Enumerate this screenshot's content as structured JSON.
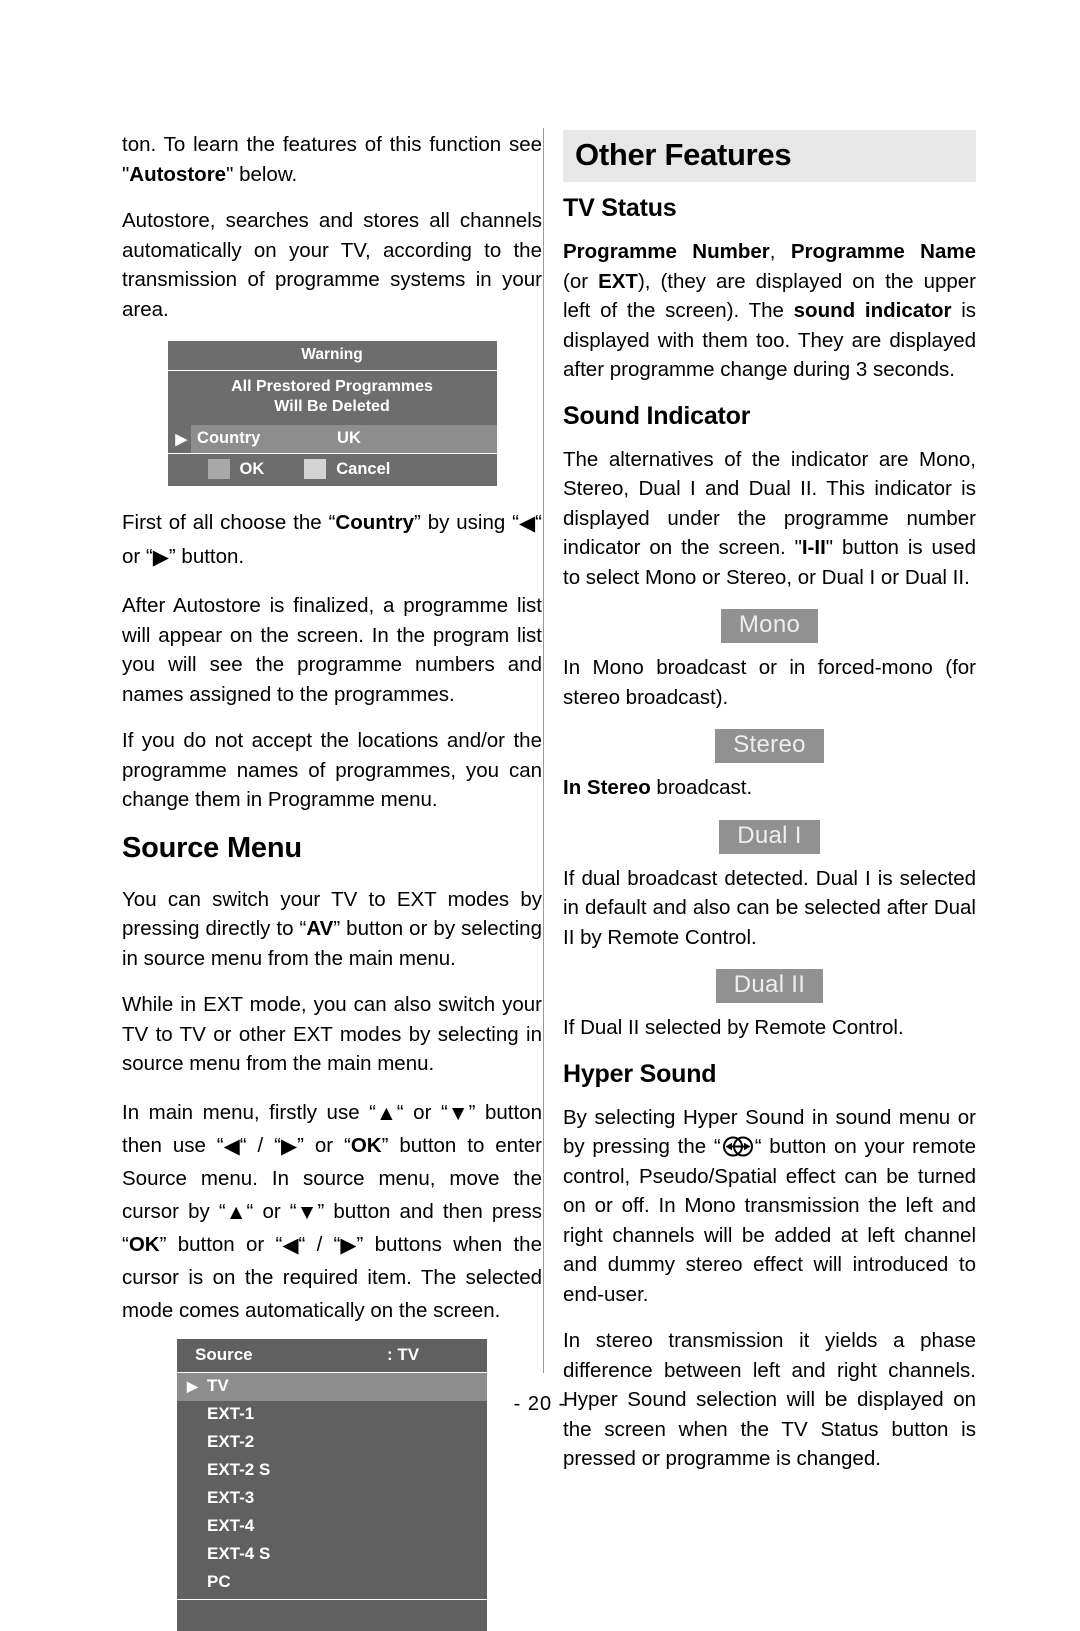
{
  "page": {
    "number_label": "- 20 -"
  },
  "left_column": {
    "paragraphs": {
      "p1_a": "ton. To learn the features of this function see \"",
      "p1_bold": "Autostore",
      "p1_b": "\" below.",
      "p2": "Autostore, searches and stores all channels automatically on your TV, according to the transmission of programme systems in your area.",
      "p3_a": "First of all choose the “",
      "p3_bold": "Country",
      "p3_b": "” by using “",
      "p3_c": "“ or “",
      "p3_d": "” button.",
      "p4": "After Autostore is finalized, a programme list will appear on the screen. In the program list you will see the programme numbers and names assigned to the programmes.",
      "p5": "If you do not accept the locations and/or the programme names of programmes, you can change them in Programme menu.",
      "p6_a": "You can switch your TV to EXT modes by pressing directly to “",
      "p6_bold": "AV",
      "p6_b": "” button or by selecting in source menu from the main menu.",
      "p7": "While in EXT mode, you can also switch your TV to TV or other EXT modes by selecting in source menu from the main menu.",
      "p8_a": "In main menu, firstly use “",
      "p8_b": "“ or “",
      "p8_c": "” button then use “",
      "p8_d": "“ / “",
      "p8_e": "” or “",
      "p8_ok1": "OK",
      "p8_f": "” button to enter Source menu. In source menu, move the cursor by “",
      "p8_g": "“ or “",
      "p8_h": "” button and then press “",
      "p8_ok2": "OK",
      "p8_i": "” button or “",
      "p8_j": "“ / “",
      "p8_k": "” buttons when the cursor is on the required item. The selected mode comes automatically on the screen."
    },
    "headings": {
      "source_menu": "Source Menu"
    },
    "warning_dialog": {
      "title": "Warning",
      "message_line1": "All Prestored  Programmes",
      "message_line2": "Will Be Deleted",
      "country_key": "Country",
      "country_value": "UK",
      "ok_label": "OK",
      "cancel_label": "Cancel",
      "colors": {
        "background": "#6d6d6d",
        "highlight": "#8d8d8d",
        "ok_swatch": "#a8a8a8",
        "cancel_swatch": "#d4d4d4"
      }
    },
    "source_dialog": {
      "title": "Source",
      "value": ": TV",
      "items": [
        "TV",
        "EXT-1",
        "EXT-2",
        "EXT-2 S",
        "EXT-3",
        "EXT-4",
        "EXT-4 S",
        "PC"
      ],
      "selected_index": 0,
      "colors": {
        "background": "#606060",
        "highlight": "#8d8d8d"
      }
    }
  },
  "right_column": {
    "banner_title": "Other Features",
    "headings": {
      "tv_status": "TV Status",
      "sound_indicator": "Sound Indicator",
      "hyper_sound": "Hyper Sound"
    },
    "paragraphs": {
      "tv_status_a_bold": "Programme Number",
      "tv_status_b": ", ",
      "tv_status_c_bold": "Programme Name",
      "tv_status_d": " (or ",
      "tv_status_e_bold": "EXT",
      "tv_status_f": "), (they are displayed on the upper left of the screen). The ",
      "tv_status_g_bold": "sound indicator",
      "tv_status_h": " is displayed with them too. They are displayed after programme change during 3 seconds.",
      "sound_ind_a": "The alternatives of the indicator are Mono, Stereo, Dual I and Dual II. This indicator is displayed under the programme number indicator on the screen. \"",
      "sound_ind_bold": "I-II",
      "sound_ind_b": "\" button is used to select Mono or Stereo, or Dual I or Dual II.",
      "mono_desc": "In Mono broadcast or in forced-mono (for stereo broadcast).",
      "stereo_desc_bold": "In Stereo",
      "stereo_desc": " broadcast.",
      "dual1_desc": "If dual broadcast detected. Dual I is selected in default and also can be selected after Dual II by Remote Control.",
      "dual2_desc": "If Dual II selected by Remote Control.",
      "hyper_a": "By selecting Hyper Sound in sound menu or by pressing the “",
      "hyper_b": "“ button on your remote control, Pseudo/Spatial effect can be turned on or off. In Mono transmission the left and right channels will be added at left channel and dummy stereo effect will introduced to end-user.",
      "hyper_c": "In stereo transmission it yields a phase difference between left and right channels. Hyper Sound selection will be displayed on the screen when the TV Status button is pressed or programme is changed."
    },
    "indicator_badges": [
      {
        "label": "Mono"
      },
      {
        "label": "Stereo"
      },
      {
        "label": "Dual I"
      },
      {
        "label": "Dual II"
      }
    ],
    "badge_colors": {
      "background": "#919191",
      "text": "#eeeeee"
    },
    "banner_background": "#e7e7e7"
  }
}
